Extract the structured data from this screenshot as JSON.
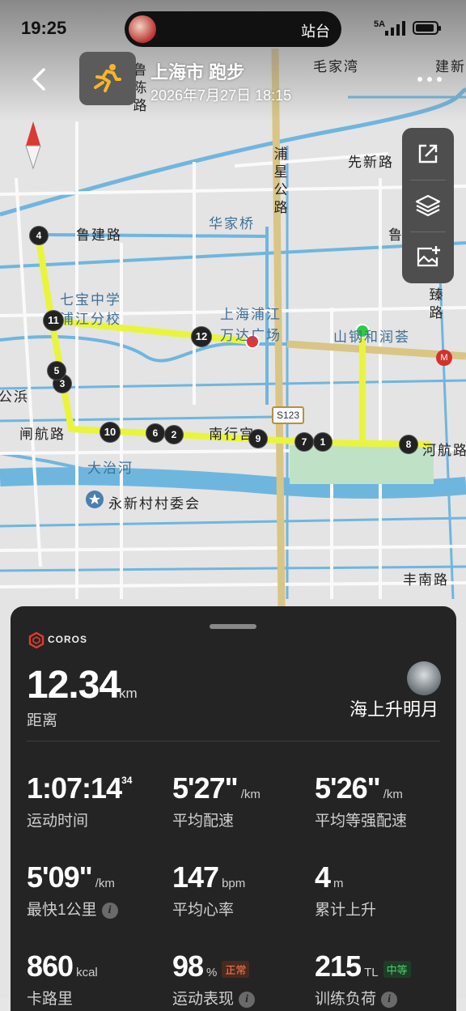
{
  "status_bar": {
    "time": "19:25",
    "pill_label": "站台",
    "network": "5A"
  },
  "header": {
    "title": "上海市 跑步",
    "subtitle": "2026年7月27日 18:15"
  },
  "map": {
    "labels": {
      "minjianlu_top": "毛家湾",
      "jianxin": "建新",
      "xinxinlu": "先新路",
      "lujianlu": "鲁建路",
      "lujianlu_right": "鲁建路",
      "huajiaqiao": "华家桥",
      "qibao_school_1": "七宝中学",
      "qibao_school_2": "浦江分校",
      "wanda_1": "上海浦江",
      "wanda_2": "万达广场",
      "shanhe": "山钢和润荟",
      "gongbin": "公浜",
      "zhahanglu": "闸航路",
      "nanxing": "南行宫",
      "hehanglu": "河航路",
      "dazhihe": "大治河",
      "yongxin": "永新村村委会",
      "fengnanlu": "丰南路",
      "puxing_road": "浦星公路",
      "luchen_road": "鲁陈路",
      "huizhen_road": "汇臻路",
      "road_shield": "S123",
      "metro": "汇"
    },
    "markers": [
      "1",
      "2",
      "3",
      "4",
      "5",
      "6",
      "7",
      "8",
      "9",
      "10",
      "11",
      "12"
    ],
    "start_color": "#2ecc40",
    "end_color": "#e8313a",
    "route_color": "#e9f53a"
  },
  "toolbar": {
    "share": "share-icon",
    "layers": "layers-icon",
    "image": "image-add-icon"
  },
  "panel": {
    "brand": "COROS",
    "distance": {
      "value": "12.34",
      "unit": "km",
      "label": "距离"
    },
    "user": {
      "name": "海上升明月"
    },
    "stats": [
      {
        "value": "1:07:14",
        "sup": "34",
        "unit": "",
        "label": "运动时间"
      },
      {
        "value": "5'27\"",
        "unit": "/km",
        "label": "平均配速"
      },
      {
        "value": "5'26\"",
        "unit": "/km",
        "label": "平均等强配速"
      },
      {
        "value": "5'09\"",
        "unit": "/km",
        "label": "最快1公里"
      },
      {
        "value": "147",
        "unit": "bpm",
        "label": "平均心率"
      },
      {
        "value": "4",
        "unit": "m",
        "label": "累计上升"
      },
      {
        "value": "860",
        "unit": "kcal",
        "label": "卡路里"
      },
      {
        "value": "98",
        "unit": "%",
        "tag": "正常",
        "label": "运动表现"
      },
      {
        "value": "215",
        "unit": "TL",
        "tag": "中等",
        "label": "训练负荷"
      }
    ]
  }
}
